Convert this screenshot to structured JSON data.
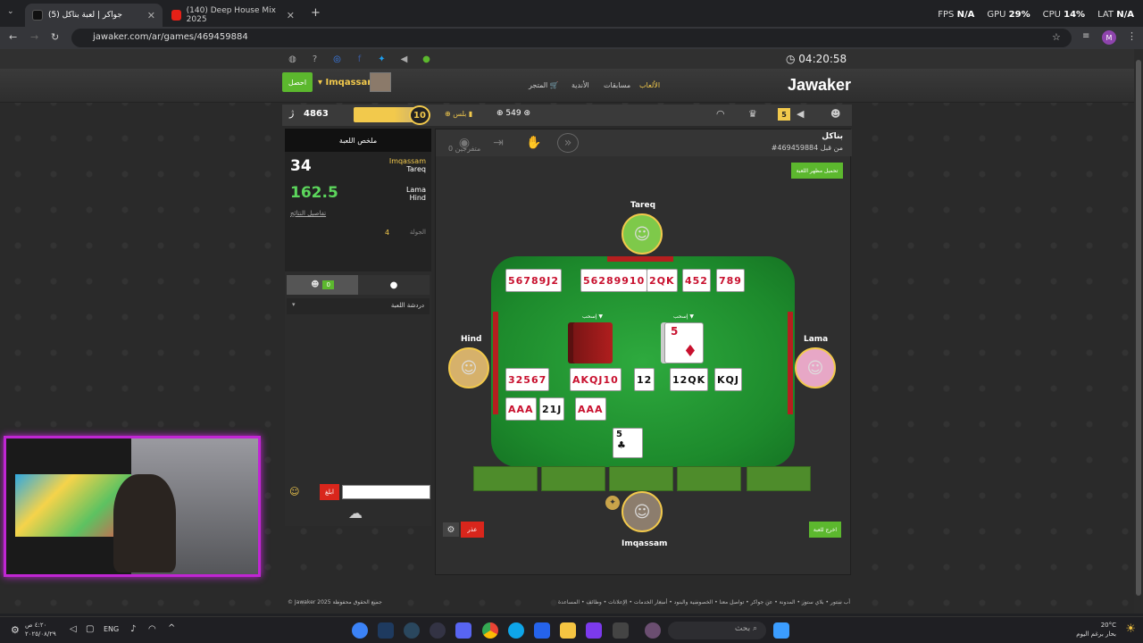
{
  "browser": {
    "tabs": [
      {
        "title": "(5) جواكر | لعبة بناكل",
        "active": true
      },
      {
        "title": "(140) Deep House Mix 2025",
        "active": false
      }
    ],
    "url": "jawaker.com/ar/games/469459884",
    "profile_initial": "M"
  },
  "perf": {
    "fps_label": "FPS",
    "fps": "N/A",
    "gpu_label": "GPU",
    "gpu": "29%",
    "cpu_label": "CPU",
    "cpu": "14%",
    "lat_label": "LAT",
    "lat": "N/A"
  },
  "site": {
    "clock": "04:20:58",
    "logo": "Jawaker",
    "nav": {
      "games": "الألعاب",
      "tournaments": "مسابقات",
      "clubs": "الأندية",
      "shop": "المتجر"
    },
    "login_label": "احصل",
    "username": "Imqassam",
    "status": {
      "coins": "4863",
      "level": "10",
      "gold_label": "بلس",
      "points": "549",
      "notifications": "5"
    }
  },
  "left_panel": {
    "summary_title": "ملخص اللعبة",
    "team1": {
      "score": "34",
      "player1": "Imqassam",
      "player2": "Tareq"
    },
    "team2": {
      "score": "162.5",
      "player1": "Lama",
      "player2": "Hind"
    },
    "details_link": "تفاصيل النتائج",
    "round_label": "الجولة",
    "round_value": "4",
    "users_count": "0",
    "chat_section": "دردشة اللعبة",
    "send_label": "ابلغ"
  },
  "game": {
    "title": "بناكل",
    "id": "#469459884 من قبل",
    "spectators": "0 متفرجين",
    "theme_button": "تحميل مظهر اللعبة",
    "players": {
      "top": "Tareq",
      "left": "Hind",
      "right": "Lama",
      "bottom": "Imqassam"
    },
    "pile_label_left": "إسحب",
    "pile_label_right": "إسحب",
    "discard_card": "5",
    "bottom_card": "5",
    "melds_top": [
      {
        "text": "56789J2",
        "color": "red"
      },
      {
        "text": "56289910",
        "color": "red"
      },
      {
        "text": "2QK",
        "color": "red"
      },
      {
        "text": "452",
        "color": "red"
      },
      {
        "text": "789",
        "color": "red"
      }
    ],
    "melds_mid": [
      {
        "text": "32567",
        "color": "red"
      },
      {
        "text": "AKQJ10",
        "color": "red"
      },
      {
        "text": "12",
        "color": "black"
      },
      {
        "text": "12QK",
        "color": "black"
      },
      {
        "text": "KQJ",
        "color": "black"
      }
    ],
    "melds_low": [
      {
        "text": "AAA",
        "color": "red"
      },
      {
        "text": "21J",
        "color": "black"
      },
      {
        "text": "AAA",
        "color": "red"
      }
    ],
    "excuse_button": "عذر",
    "deal_button": "اخرج للعبة"
  },
  "footer": {
    "links": "أب ستور • بلاي ستور • المدونة • عن جواكر • تواصل معنا • الخصوصية والبنود • أسعار الخدمات • الإعلانات • وظائف • المساعدة",
    "copyright": "© Jawaker 2025 جميع الحقوق محفوظة"
  },
  "taskbar": {
    "time": "٤:٢٠ ص",
    "date": "٢٠٢٥/٠٨/٢٩",
    "lang": "ENG",
    "search": "بحث",
    "weather_temp": "20°C",
    "weather_desc": "بحار برغم اليوم"
  }
}
